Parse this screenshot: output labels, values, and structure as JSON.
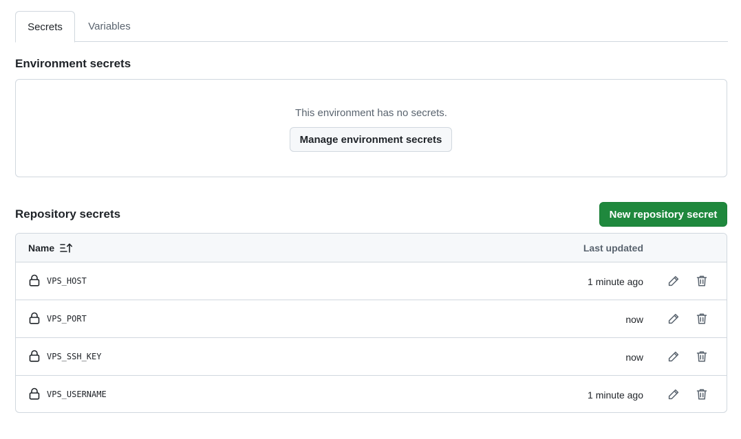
{
  "tabs": [
    {
      "label": "Secrets",
      "selected": true
    },
    {
      "label": "Variables",
      "selected": false
    }
  ],
  "environment_secrets": {
    "title": "Environment secrets",
    "empty_text": "This environment has no secrets.",
    "manage_button": "Manage environment secrets"
  },
  "repository_secrets": {
    "title": "Repository secrets",
    "new_button": "New repository secret",
    "columns": {
      "name": "Name",
      "last_updated": "Last updated"
    },
    "rows": [
      {
        "name": "VPS_HOST",
        "updated": "1 minute ago"
      },
      {
        "name": "VPS_PORT",
        "updated": "now"
      },
      {
        "name": "VPS_SSH_KEY",
        "updated": "now"
      },
      {
        "name": "VPS_USERNAME",
        "updated": "1 minute ago"
      }
    ]
  },
  "icons": {
    "sort": "sort-ascending-icon",
    "lock": "lock-icon",
    "edit": "pencil-icon",
    "delete": "trash-icon"
  },
  "colors": {
    "primary_button": "#1f883d",
    "border": "#d0d7de",
    "header_bg": "#f6f8fa",
    "muted_text": "#59636e"
  }
}
